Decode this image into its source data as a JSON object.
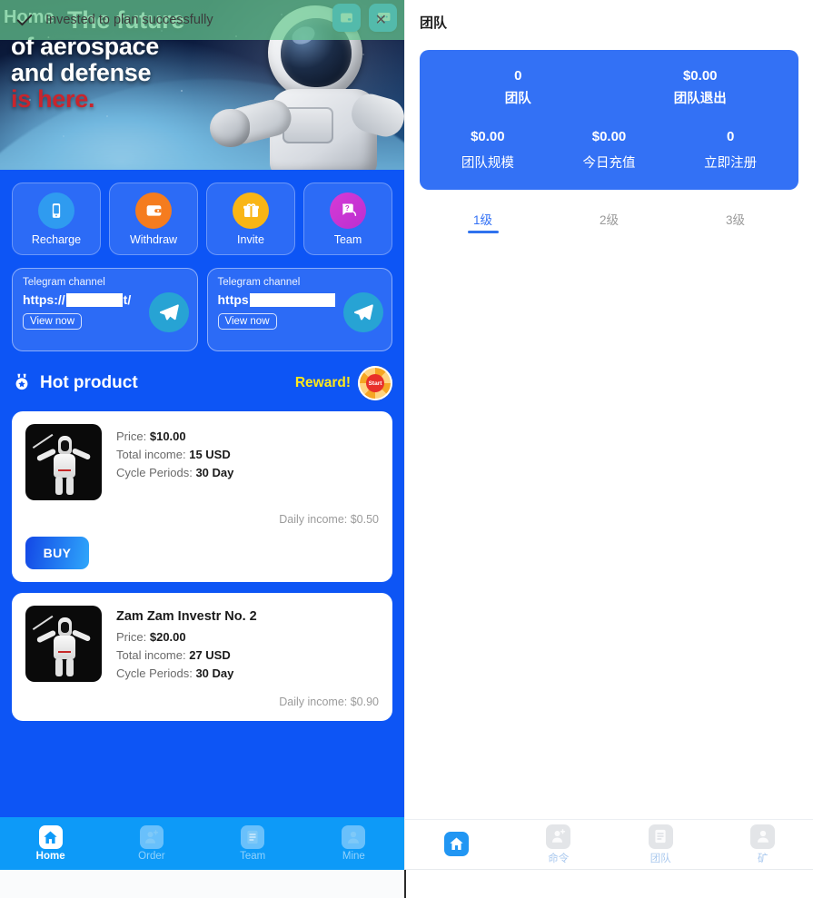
{
  "toast": {
    "message": "Invested to plan successfully",
    "check_icon": "check-icon",
    "close_icon": "close-icon"
  },
  "left_app": {
    "page_label": "Home",
    "banner": {
      "line1": "The future",
      "line2": "of aerospace",
      "line3": "and defense",
      "line4": "is here.",
      "icons": [
        "mail-icon",
        "chat-icon"
      ]
    },
    "actions": [
      {
        "label": "Recharge",
        "icon": "mobile-phone-icon",
        "color": "#2f9bf0"
      },
      {
        "label": "Withdraw",
        "icon": "wallet-icon",
        "color": "#f57c1f"
      },
      {
        "label": "Invite",
        "icon": "gift-icon",
        "color": "#f9b515"
      },
      {
        "label": "Team",
        "icon": "chat-question-icon",
        "color": "#cc33cc"
      }
    ],
    "telegram_cards": [
      {
        "title": "Telegram channel",
        "url_prefix": "https://",
        "url_suffix": "t/",
        "button": "View now",
        "icon": "telegram-icon"
      },
      {
        "title": "Telegram channel",
        "url_prefix": "https",
        "url_suffix": "",
        "button": "View now",
        "icon": "telegram-icon"
      }
    ],
    "hot_section": {
      "title": "Hot product",
      "title_icon": "medal-star-icon",
      "reward_label": "Reward!",
      "reward_icon": "spin-wheel-start-icon",
      "reward_icon_text": "Start"
    },
    "products": [
      {
        "name": "",
        "price_label": "Price:",
        "price_value": "$10.00",
        "income_label": "Total income:",
        "income_value": "15 USD",
        "cycle_label": "Cycle Periods:",
        "cycle_value": "30 Day",
        "daily": "Daily income: $0.50",
        "buy_label": "BUY",
        "image": "humanoid-robot-photo"
      },
      {
        "name": "Zam Zam Investr No. 2",
        "price_label": "Price:",
        "price_value": "$20.00",
        "income_label": "Total income:",
        "income_value": "27 USD",
        "cycle_label": "Cycle Periods:",
        "cycle_value": "30 Day",
        "daily": "Daily income: $0.90",
        "buy_label": "",
        "image": "humanoid-robot-photo"
      }
    ],
    "bottom_nav": [
      {
        "label": "Home",
        "icon": "home-icon",
        "active": true
      },
      {
        "label": "Order",
        "icon": "add-person-icon",
        "active": false
      },
      {
        "label": "Team",
        "icon": "document-icon",
        "active": false
      },
      {
        "label": "Mine",
        "icon": "person-icon",
        "active": false
      }
    ]
  },
  "right_app": {
    "title": "团队",
    "stats_top": [
      {
        "value": "0",
        "label": "团队"
      },
      {
        "value": "$0.00",
        "label": "团队退出"
      }
    ],
    "stats_bottom": [
      {
        "value": "$0.00",
        "label": "团队规模"
      },
      {
        "value": "$0.00",
        "label": "今日充值"
      },
      {
        "value": "0",
        "label": "立即注册"
      }
    ],
    "level_tabs": [
      {
        "label": "1级",
        "active": true
      },
      {
        "label": "2级",
        "active": false
      },
      {
        "label": "3级",
        "active": false
      }
    ],
    "bottom_nav": [
      {
        "label": "",
        "icon": "home-icon",
        "active": true
      },
      {
        "label": "命令",
        "icon": "add-person-icon",
        "active": false
      },
      {
        "label": "团队",
        "icon": "document-icon",
        "active": false
      },
      {
        "label": "矿",
        "icon": "person-icon",
        "active": false
      }
    ]
  },
  "colors": {
    "app_blue": "#0d55f5",
    "nav_blue": "#0d9af8",
    "card_blue": "#3371f5",
    "toast_green": "#67c78f",
    "reward_yellow": "#ffe81a"
  }
}
